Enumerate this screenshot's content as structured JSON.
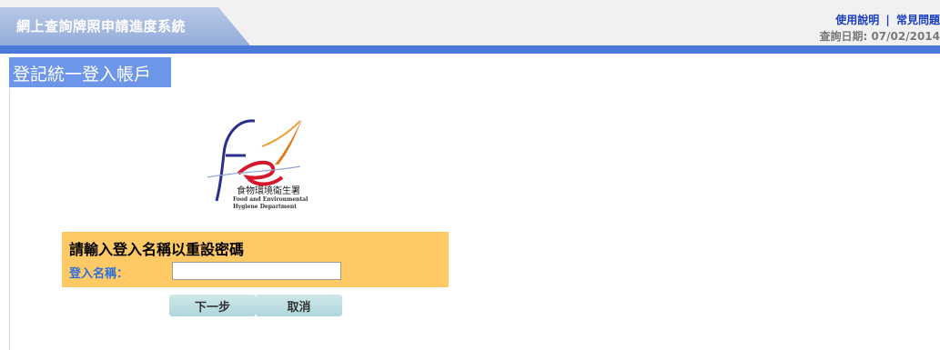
{
  "header": {
    "app_title": "網上查詢牌照申請進度系統",
    "links": {
      "help": "使用說明",
      "separator": "|",
      "faq": "常見問題"
    },
    "query_date": "查詢日期: 07/02/2014"
  },
  "page": {
    "heading": "登記統一登入帳戶"
  },
  "logo": {
    "name_cn": "食物環境衞生署",
    "name_en_line1": "Food and Environmental",
    "name_en_line2": "Hygiene Department"
  },
  "form": {
    "title": "請輸入登入名稱以重設密碼",
    "login_label": "登入名稱：",
    "login_value": "",
    "next_button": "下一步",
    "cancel_button": "取消"
  },
  "colors": {
    "header_tab": "#95addb",
    "blue_bar": "#4a79d9",
    "heading_bg": "#6d95e8",
    "form_bg": "#ffc966",
    "button_bg": "#aed6da",
    "link": "#1a3fbf"
  }
}
